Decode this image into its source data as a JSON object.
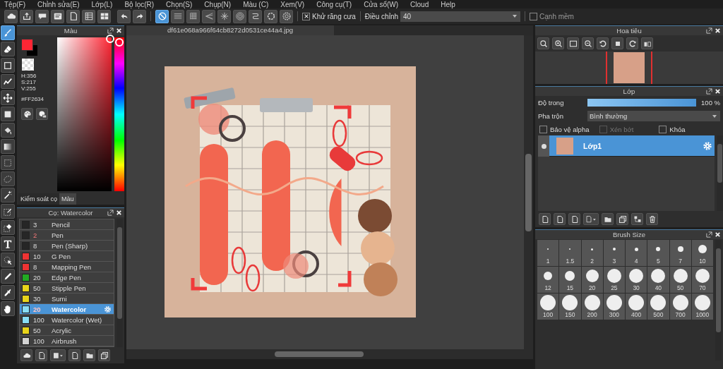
{
  "menu": [
    "Tệp(F)",
    "Chỉnh sửa(E)",
    "Lớp(L)",
    "Bộ lọc(R)",
    "Chọn(S)",
    "Chụp(N)",
    "Màu (C)",
    "Xem(V)",
    "Công cụ(T)",
    "Cửa sổ(W)",
    "Cloud",
    "Help"
  ],
  "toolbar": {
    "buttons": [
      {
        "kind": "cloud"
      },
      {
        "kind": "share"
      },
      {
        "kind": "speech"
      },
      {
        "kind": "note"
      },
      {
        "kind": "page"
      },
      {
        "kind": "list"
      },
      {
        "kind": "grid-edit"
      },
      {
        "kind": "undo"
      },
      {
        "kind": "redo"
      }
    ],
    "guides": [
      {
        "kind": "no-guide",
        "selected": true
      },
      {
        "kind": "parallel-lines",
        "selected": false
      },
      {
        "kind": "grid",
        "selected": false
      },
      {
        "kind": "perspective",
        "selected": false
      },
      {
        "kind": "radial",
        "selected": false
      },
      {
        "kind": "concentric",
        "selected": false
      },
      {
        "kind": "curve",
        "selected": false
      },
      {
        "kind": "circle",
        "selected": false
      },
      {
        "kind": "cog",
        "selected": false
      }
    ],
    "antialias": {
      "label": "Khử răng cưa",
      "checked": true
    },
    "correction": {
      "label": "Điều chỉnh",
      "value": "40"
    },
    "soft_edge": {
      "label": "Cạnh mềm",
      "checked": false
    }
  },
  "tools": [
    {
      "kind": "brush",
      "selected": true
    },
    {
      "kind": "eraser",
      "selected": false
    },
    {
      "kind": "rect-outline",
      "selected": false
    },
    {
      "kind": "zigzag",
      "selected": false
    },
    {
      "kind": "move",
      "selected": false
    },
    {
      "kind": "square",
      "selected": false
    },
    {
      "kind": "bucket",
      "selected": false
    },
    {
      "kind": "gradient",
      "selected": false
    },
    {
      "kind": "dotted-rect",
      "selected": false
    },
    {
      "kind": "lasso",
      "selected": false
    },
    {
      "kind": "wand",
      "selected": false
    },
    {
      "kind": "select-pen",
      "selected": false
    },
    {
      "kind": "select-eraser",
      "selected": false
    },
    {
      "kind": "text",
      "selected": false
    },
    {
      "kind": "pointer",
      "selected": false
    },
    {
      "kind": "pen",
      "selected": false
    },
    {
      "kind": "eyedropper",
      "selected": false
    },
    {
      "kind": "hand",
      "selected": false
    }
  ],
  "color_panel": {
    "title": "Màu",
    "hue": {
      "level": 0.01
    },
    "hsv": [
      "H:356",
      "S:217",
      "V:255"
    ],
    "hex": "#FF2634",
    "tabs": [
      {
        "label": "Kiểm soát cọ",
        "selected": false
      },
      {
        "label": "Màu",
        "selected": true
      }
    ]
  },
  "brush_panel": {
    "title": "Cọ: Watercolor",
    "brushes": [
      {
        "color": "#262626",
        "size": "3",
        "name": "Pencil",
        "selected": false,
        "modified": false
      },
      {
        "color": "#262626",
        "size": "2",
        "name": "Pen",
        "selected": false,
        "modified": true
      },
      {
        "color": "#262626",
        "size": "8",
        "name": "Pen (Sharp)",
        "selected": false,
        "modified": false
      },
      {
        "color": "#ee3333",
        "size": "10",
        "name": "G Pen",
        "selected": false,
        "modified": false
      },
      {
        "color": "#ee3333",
        "size": "8",
        "name": "Mapping Pen",
        "selected": false,
        "modified": false
      },
      {
        "color": "#22aa22",
        "size": "20",
        "name": "Edge Pen",
        "selected": false,
        "modified": false
      },
      {
        "color": "#e8d41a",
        "size": "50",
        "name": "Stipple Pen",
        "selected": false,
        "modified": false
      },
      {
        "color": "#e8d41a",
        "size": "30",
        "name": "Sumi",
        "selected": false,
        "modified": false
      },
      {
        "color": "#88ddf5",
        "size": "20",
        "name": "Watercolor",
        "selected": true,
        "modified": true
      },
      {
        "color": "#88ddf5",
        "size": "100",
        "name": "Watercolor (Wet)",
        "selected": false,
        "modified": false
      },
      {
        "color": "#e8d41a",
        "size": "50",
        "name": "Acrylic",
        "selected": false,
        "modified": false
      },
      {
        "color": "#d4d4d4",
        "size": "100",
        "name": "Airbrush",
        "selected": false,
        "modified": false
      }
    ]
  },
  "canvas": {
    "tab": "df61e068a966f64cb8272d0531ce44a4.jpg"
  },
  "navigator": {
    "title": "Hoa tiêu"
  },
  "layer_panel": {
    "title": "Lớp",
    "opacity": {
      "label": "Độ trong",
      "level": 1,
      "reading": "100 %"
    },
    "blend": {
      "label": "Pha trộn",
      "value": "Bình thường"
    },
    "options": [
      {
        "label": "Bảo vệ alpha",
        "checked": false,
        "disabled": false
      },
      {
        "label": "Xén bớt",
        "checked": false,
        "disabled": true
      },
      {
        "label": "Khóa",
        "checked": false,
        "disabled": false
      }
    ],
    "layers": [
      {
        "name": "Lớp1",
        "selected": true,
        "visible": true
      }
    ]
  },
  "brush_size": {
    "title": "Brush Size",
    "sizes": [
      "1",
      "1.5",
      "2",
      "3",
      "4",
      "5",
      "7",
      "10",
      "12",
      "15",
      "20",
      "25",
      "30",
      "40",
      "50",
      "70",
      "100",
      "150",
      "200",
      "300",
      "400",
      "500",
      "700",
      "1000"
    ]
  }
}
